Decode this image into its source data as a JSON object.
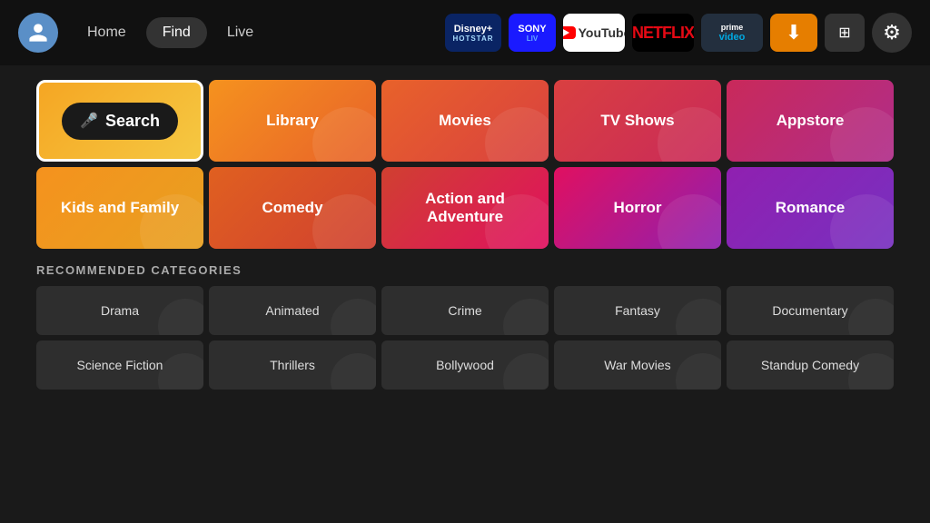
{
  "header": {
    "nav": {
      "home": "Home",
      "find": "Find",
      "live": "Live"
    },
    "apps": {
      "disney": "Disney+\nHotstar",
      "sony": "Sony\nLIV",
      "youtube": "YouTube",
      "netflix": "NETFLIX",
      "prime": "prime\nvideo",
      "downloader": "⬇",
      "multiview": "⊞",
      "settings": "⚙"
    }
  },
  "main_grid": {
    "row1": [
      {
        "label": "Search",
        "type": "search"
      },
      {
        "label": "Library",
        "type": "cell-orange"
      },
      {
        "label": "Movies",
        "type": "cell-red-orange"
      },
      {
        "label": "TV Shows",
        "type": "cell-hot-pink"
      },
      {
        "label": "Appstore",
        "type": "cell-purple-pink"
      }
    ],
    "row2": [
      {
        "label": "Kids and Family",
        "type": "cell-amber"
      },
      {
        "label": "Comedy",
        "type": "cell-orange2"
      },
      {
        "label": "Action and Adventure",
        "type": "cell-crimson"
      },
      {
        "label": "Horror",
        "type": "cell-magenta"
      },
      {
        "label": "Romance",
        "type": "cell-purple2"
      }
    ]
  },
  "recommended": {
    "title": "RECOMMENDED CATEGORIES",
    "items": [
      "Drama",
      "Animated",
      "Crime",
      "Fantasy",
      "Documentary",
      "Science Fiction",
      "Thrillers",
      "Bollywood",
      "War Movies",
      "Standup Comedy"
    ]
  }
}
